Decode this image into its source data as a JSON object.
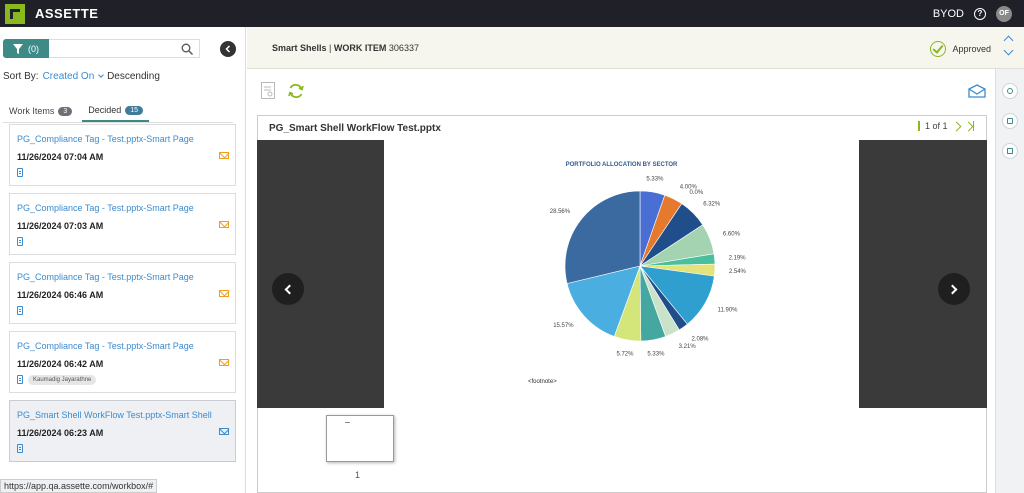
{
  "app": {
    "brand": "ASSETTE",
    "workspace": "BYOD",
    "user_initials": "OF",
    "help_glyph": "?"
  },
  "filter": {
    "count_label": "(0)"
  },
  "sort": {
    "label": "Sort By:",
    "field": "Created On",
    "order": "Descending"
  },
  "tabs": [
    {
      "label": "Work Items",
      "count": "3",
      "active": false
    },
    {
      "label": "Decided",
      "count": "15",
      "active": true
    }
  ],
  "work_items": [
    {
      "title": "PG_Compliance Tag - Test.pptx-Smart Page",
      "date": "11/26/2024 07:04 AM",
      "user": ""
    },
    {
      "title": "PG_Compliance Tag - Test.pptx-Smart Page",
      "date": "11/26/2024 07:03 AM",
      "user": ""
    },
    {
      "title": "PG_Compliance Tag - Test.pptx-Smart Page",
      "date": "11/26/2024 06:46 AM",
      "user": ""
    },
    {
      "title": "PG_Compliance Tag - Test.pptx-Smart Page",
      "date": "11/26/2024 06:42 AM",
      "user": "Kaumadig Jayarathne"
    },
    {
      "title": "PG_Smart Shell WorkFlow Test.pptx-Smart Shell",
      "date": "11/26/2024 06:23 AM",
      "user": ""
    }
  ],
  "status_url": "https://app.qa.assette.com/workbox/#",
  "header": {
    "product": "Smart Shells",
    "separator": "|",
    "work_item_label": "WORK ITEM",
    "work_item_id": "306337",
    "status": "Approved"
  },
  "viewer": {
    "file_name": "PG_Smart Shell WorkFlow Test.pptx",
    "page_indicator": "1 of 1",
    "thumb_number": "1"
  },
  "slide": {
    "footnote": "<footnote>"
  },
  "chart_data": {
    "type": "pie",
    "title": "PORTFOLIO ALLOCATION BY SECTOR",
    "values": [
      5.33,
      4.0,
      0.0,
      6.32,
      6.6,
      2.19,
      2.54,
      11.9,
      2.08,
      3.21,
      5.33,
      5.72,
      15.57,
      28.56
    ],
    "labels": [
      "5.33%",
      "4.00%",
      "0.0%",
      "6.32%",
      "6.60%",
      "2.19%",
      "2.54%",
      "11.90%",
      "2.08%",
      "3.21%",
      "5.33%",
      "5.72%",
      "15.57%",
      "28.56%"
    ],
    "colors": [
      "#4a6fd4",
      "#e57a2e",
      "#1f4e8a",
      "#1f4e8a",
      "#a3d3b0",
      "#4bbf9c",
      "#e3e37a",
      "#2f9fd0",
      "#1f4e8a",
      "#c9e2c9",
      "#45a8a0",
      "#d4e57a",
      "#4aaee0",
      "#3a6aa0"
    ]
  }
}
